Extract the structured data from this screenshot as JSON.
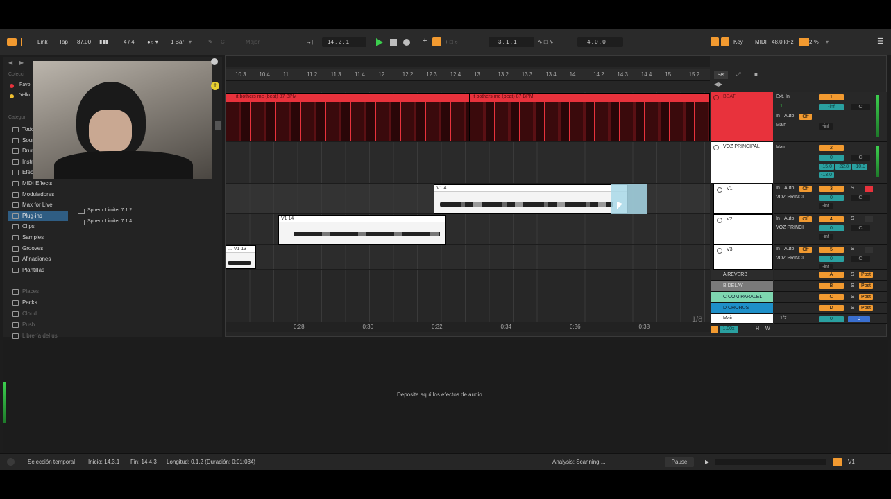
{
  "transport": {
    "link": "Link",
    "tap": "Tap",
    "tempo": "87.00",
    "signature": "4 / 4",
    "quantize": "1 Bar",
    "key": "C",
    "scale": "Major",
    "position": "14 .   2 .   1",
    "loop_start": "3 .   1 .   1",
    "loop_length": "4 .   0 .   0",
    "key_label": "Key",
    "midi_label": "MIDI",
    "sample_rate": "48.0 kHz",
    "cpu": "2 %"
  },
  "browser": {
    "collections_title": "Colecci",
    "col_items": [
      "Favo",
      "Yello"
    ],
    "categories_title": "Categor",
    "categories": [
      "Todo",
      "Soun",
      "Drum",
      "Instr",
      "Efec",
      "MIDI Effects",
      "Moduladores",
      "Max for Live",
      "Plug-ins",
      "Clips",
      "Samples",
      "Grooves",
      "Afinaciones",
      "Plantillas"
    ],
    "places": [
      "Places",
      "Packs",
      "Cloud",
      "Push",
      "Librería del us"
    ],
    "files": [
      "Spherix Limiter 7.1.2",
      "Spherix Limiter 7.1.4"
    ]
  },
  "arrangement": {
    "ruler": [
      "10.3",
      "10.4",
      "11",
      "11.2",
      "11.3",
      "11.4",
      "12",
      "12.2",
      "12.3",
      "12.4",
      "13",
      "13.2",
      "13.3",
      "13.4",
      "14",
      "14.2",
      "14.3",
      "14.4",
      "15",
      "15.2"
    ],
    "set_label": "Set",
    "time_ticks": [
      "0:28",
      "0:30",
      "0:32",
      "0:34",
      "0:36",
      "0:38"
    ],
    "zoom": "1/8",
    "follow": "1.00x",
    "h_label": "H",
    "w_label": "W"
  },
  "clips": {
    "beat_a": "it bothers me (beat) 87 BPM",
    "beat_b": "it bothers me (beat) 87 BPM",
    "v1": "V1 4",
    "v1_14": "V1 14",
    "v1_13": "... V1 13"
  },
  "tracks": [
    {
      "name": "BEAT",
      "num": "1",
      "input": "Ext. In",
      "channel": "1",
      "monitor": "In",
      "auto": "Auto",
      "off": "Off",
      "out": "Main",
      "vol": "-inf",
      "pan": "C"
    },
    {
      "name": "VOZ PRINCIPAL",
      "num": "2",
      "out": "Main",
      "vol": "0",
      "pan": "C",
      "meter_a": "-15.0",
      "meter_b": "-22.8",
      "meter_c": "-10.0",
      "meter_d": "-13.0"
    },
    {
      "name": "V1",
      "num": "3",
      "monitor": "In",
      "auto": "Auto",
      "off": "Off",
      "out": "VOZ PRINCI",
      "vol": "0",
      "pan": "C",
      "minf": "-inf"
    },
    {
      "name": "V2",
      "num": "4",
      "monitor": "In",
      "auto": "Auto",
      "off": "Off",
      "out": "VOZ PRINCI",
      "vol": "0",
      "pan": "C",
      "minf": "-inf"
    },
    {
      "name": "V3",
      "num": "5",
      "monitor": "In",
      "auto": "Auto",
      "off": "Off",
      "out": "VOZ PRINCI",
      "vol": "0",
      "pan": "C",
      "minf": "-inf"
    }
  ],
  "returns": [
    {
      "name": "A REVERB",
      "letter": "A"
    },
    {
      "name": "B DELAY",
      "letter": "B"
    },
    {
      "name": "C COM PARALEL",
      "letter": "C"
    },
    {
      "name": "D CHORUS",
      "letter": "D"
    }
  ],
  "main": {
    "name": "Main",
    "out": "1/2",
    "vol": "0",
    "pan": "0"
  },
  "solo": "S",
  "post": "Post",
  "device_drop": "Deposita aquí los efectos de audio",
  "status": {
    "mode": "Selección temporal",
    "start": "Inicio: 14.3.1",
    "end": "Fin: 14.4.3",
    "length": "Longitud: 0.1.2  (Duración: 0:01:034)",
    "analysis": "Analysis: Scanning ...",
    "pause": "Pause",
    "track": "V1"
  },
  "colors": {
    "beat": "#e8323c",
    "accent": "#f29a30",
    "selection": "#2f5d83",
    "teal": "#2aa0a0",
    "v1_sel": "#a8d8e8"
  }
}
